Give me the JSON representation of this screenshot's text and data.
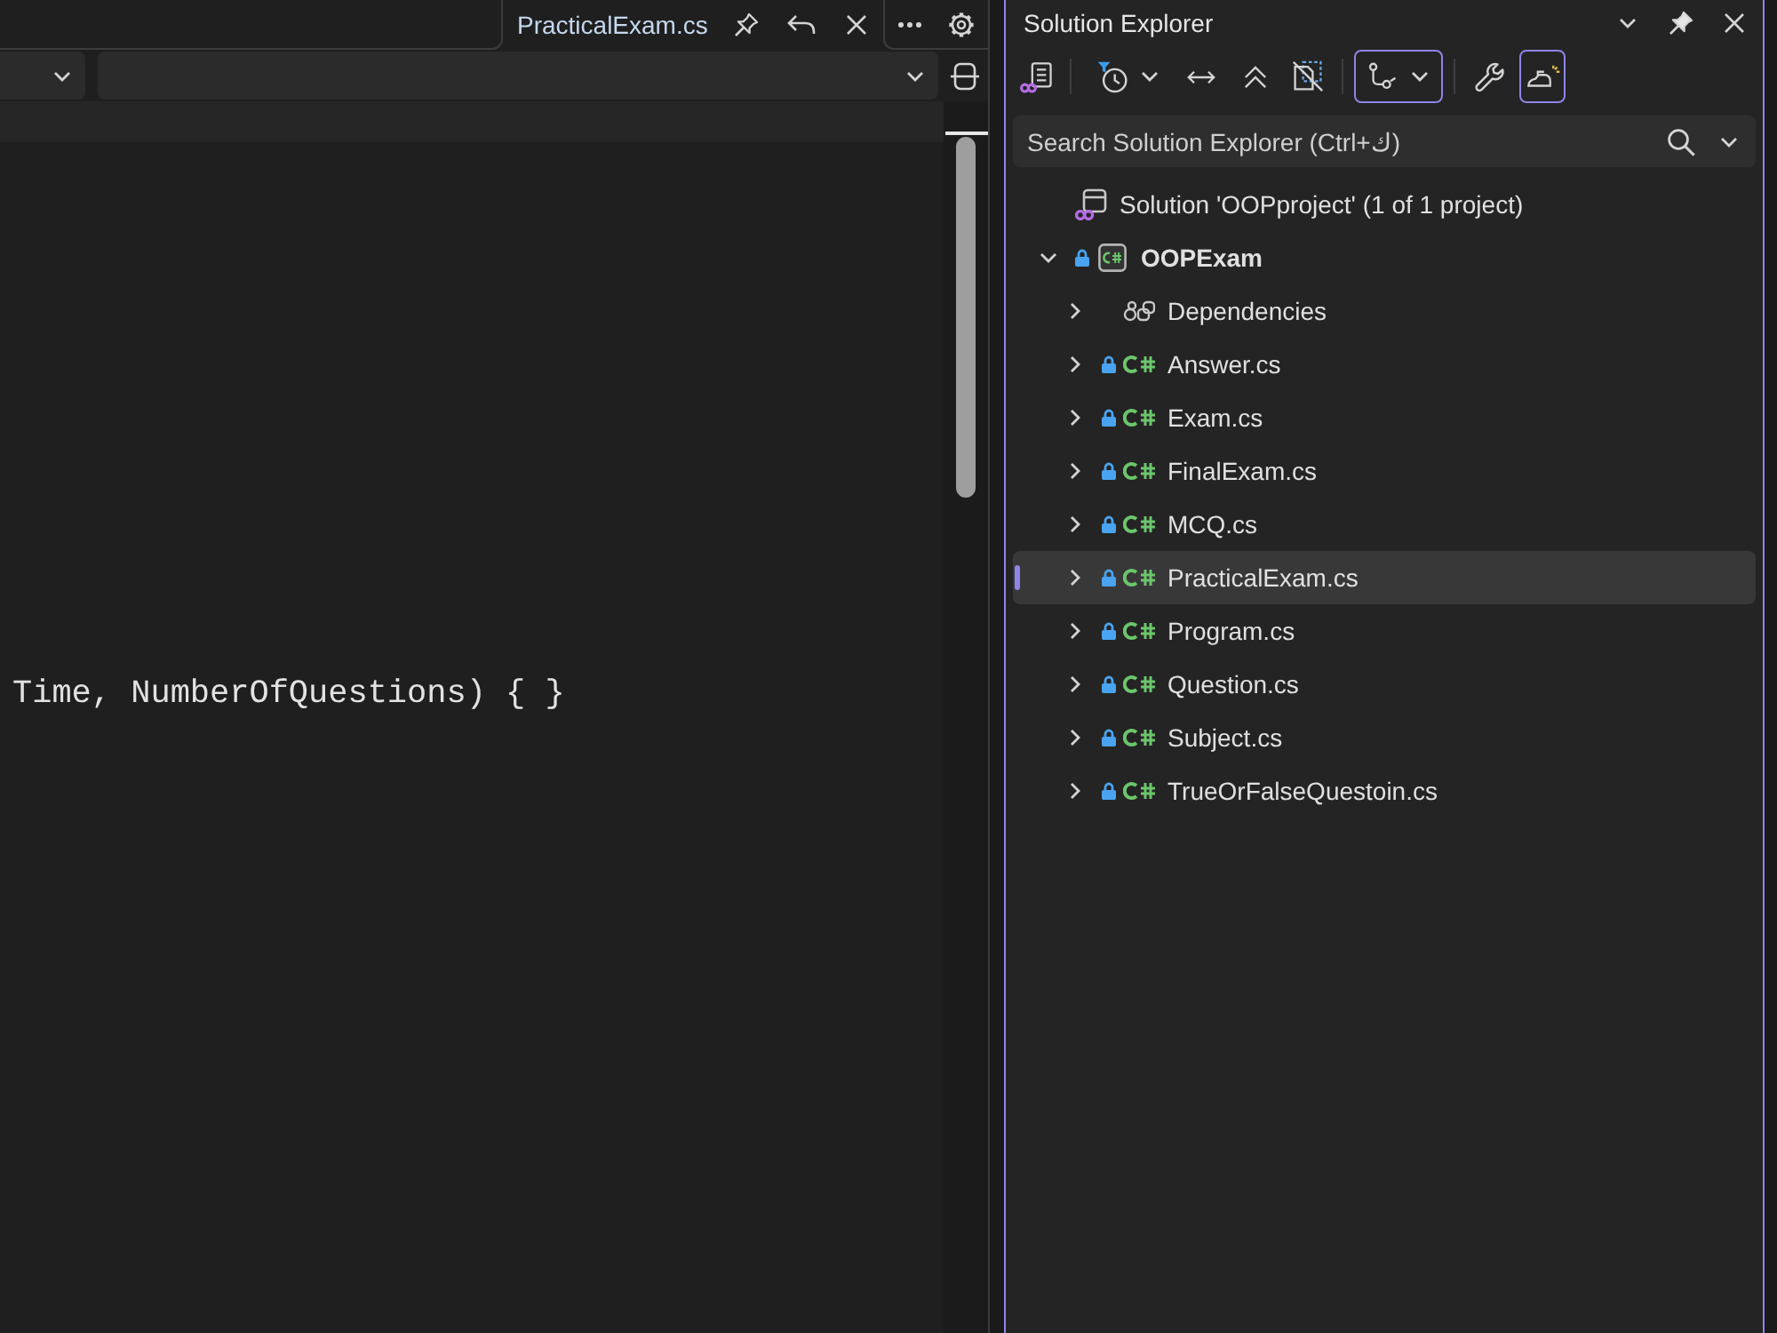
{
  "editor": {
    "tabs": [
      {
        "label": "PracticalExam.cs",
        "selected": true
      }
    ],
    "code_lines": [
      "Time, NumberOfQuestions) { }"
    ]
  },
  "solution_explorer": {
    "title": "Solution Explorer",
    "toolbar": [
      {
        "toggled": false
      },
      {
        "toggled": false
      },
      {
        "toggled": false
      },
      {
        "toggled": false
      },
      {
        "toggled": false
      },
      {
        "toggled": true
      },
      {
        "toggled": false
      },
      {
        "toggled": true
      }
    ],
    "search": {
      "placeholder": "Search Solution Explorer (Ctrl+ك)"
    },
    "tree": [
      {
        "kind": "solution",
        "label": "Solution 'OOPproject' (1 of 1 project)",
        "locked": false,
        "selected": false
      },
      {
        "kind": "project",
        "label": "OOPExam",
        "expanded": true,
        "locked": true,
        "selected": false,
        "children": [
          {
            "kind": "dependencies",
            "label": "Dependencies",
            "expanded": false,
            "locked": false,
            "selected": false
          },
          {
            "kind": "file",
            "label": "Answer.cs",
            "expanded": false,
            "locked": true,
            "selected": false
          },
          {
            "kind": "file",
            "label": "Exam.cs",
            "expanded": false,
            "locked": true,
            "selected": false
          },
          {
            "kind": "file",
            "label": "FinalExam.cs",
            "expanded": false,
            "locked": true,
            "selected": false
          },
          {
            "kind": "file",
            "label": "MCQ.cs",
            "expanded": false,
            "locked": true,
            "selected": false
          },
          {
            "kind": "file",
            "label": "PracticalExam.cs",
            "expanded": false,
            "locked": true,
            "selected": true
          },
          {
            "kind": "file",
            "label": "Program.cs",
            "expanded": false,
            "locked": true,
            "selected": false
          },
          {
            "kind": "file",
            "label": "Question.cs",
            "expanded": false,
            "locked": true,
            "selected": false
          },
          {
            "kind": "file",
            "label": "Subject.cs",
            "expanded": false,
            "locked": true,
            "selected": false
          },
          {
            "kind": "file",
            "label": "TrueOrFalseQuestoin.cs",
            "expanded": false,
            "locked": true,
            "selected": false
          }
        ]
      }
    ]
  }
}
